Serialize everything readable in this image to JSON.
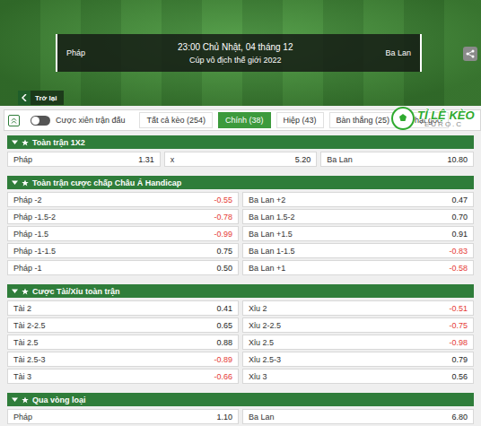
{
  "match": {
    "home": "Pháp",
    "away": "Ba Lan",
    "time": "23:00 Chủ Nhật, 04 tháng 12",
    "competition": "Cúp vô địch thế giới 2022"
  },
  "back": "Trở lại",
  "logo": {
    "title": "TỈ LỆ KÈO",
    "subtitle": "EURO.C"
  },
  "toggle": {
    "label": "Cược xiên trận đấu",
    "on": false
  },
  "tabs": [
    {
      "label": "Tất cả kèo (254)",
      "selected": false
    },
    {
      "label": "Chính (38)",
      "selected": true
    },
    {
      "label": "Hiệp (43)",
      "selected": false
    },
    {
      "label": "Bàn thắng (25)",
      "selected": false
    },
    {
      "label": "Phạt góc",
      "selected": false
    }
  ],
  "sections": [
    {
      "title": "Toàn trận 1X2",
      "expanded": true,
      "rows": [
        [
          {
            "label": "Pháp",
            "odds": "1.31"
          },
          {
            "label": "x",
            "odds": "5.20"
          },
          {
            "label": "Ba Lan",
            "odds": "10.80"
          }
        ]
      ]
    },
    {
      "title": "Toàn trận cược chấp Châu Á Handicap",
      "expanded": true,
      "rows": [
        [
          {
            "label": "Pháp -2",
            "odds": "-0.55"
          },
          {
            "label": "Ba Lan +2",
            "odds": "0.47"
          }
        ],
        [
          {
            "label": "Pháp -1.5-2",
            "odds": "-0.78"
          },
          {
            "label": "Ba Lan 1.5-2",
            "odds": "0.70"
          }
        ],
        [
          {
            "label": "Pháp -1.5",
            "odds": "-0.99"
          },
          {
            "label": "Ba Lan +1.5",
            "odds": "0.91"
          }
        ],
        [
          {
            "label": "Pháp -1-1.5",
            "odds": "0.75"
          },
          {
            "label": "Ba Lan 1-1.5",
            "odds": "-0.83"
          }
        ],
        [
          {
            "label": "Pháp -1",
            "odds": "0.50"
          },
          {
            "label": "Ba Lan +1",
            "odds": "-0.58"
          }
        ]
      ]
    },
    {
      "title": "Cược Tài/Xỉu toàn trận",
      "expanded": true,
      "rows": [
        [
          {
            "label": "Tài 2",
            "odds": "0.41"
          },
          {
            "label": "Xỉu 2",
            "odds": "-0.51"
          }
        ],
        [
          {
            "label": "Tài 2-2.5",
            "odds": "0.65"
          },
          {
            "label": "Xỉu 2-2.5",
            "odds": "-0.75"
          }
        ],
        [
          {
            "label": "Tài 2.5",
            "odds": "0.88"
          },
          {
            "label": "Xỉu 2.5",
            "odds": "-0.98"
          }
        ],
        [
          {
            "label": "Tài 2.5-3",
            "odds": "-0.89"
          },
          {
            "label": "Xỉu 2.5-3",
            "odds": "0.79"
          }
        ],
        [
          {
            "label": "Tài 3",
            "odds": "-0.66"
          },
          {
            "label": "Xỉu 3",
            "odds": "0.56"
          }
        ]
      ]
    },
    {
      "title": "Qua vòng loại",
      "expanded": true,
      "rows": [
        [
          {
            "label": "Pháp",
            "odds": "1.10"
          },
          {
            "label": "Ba Lan",
            "odds": "6.80"
          }
        ]
      ]
    }
  ]
}
